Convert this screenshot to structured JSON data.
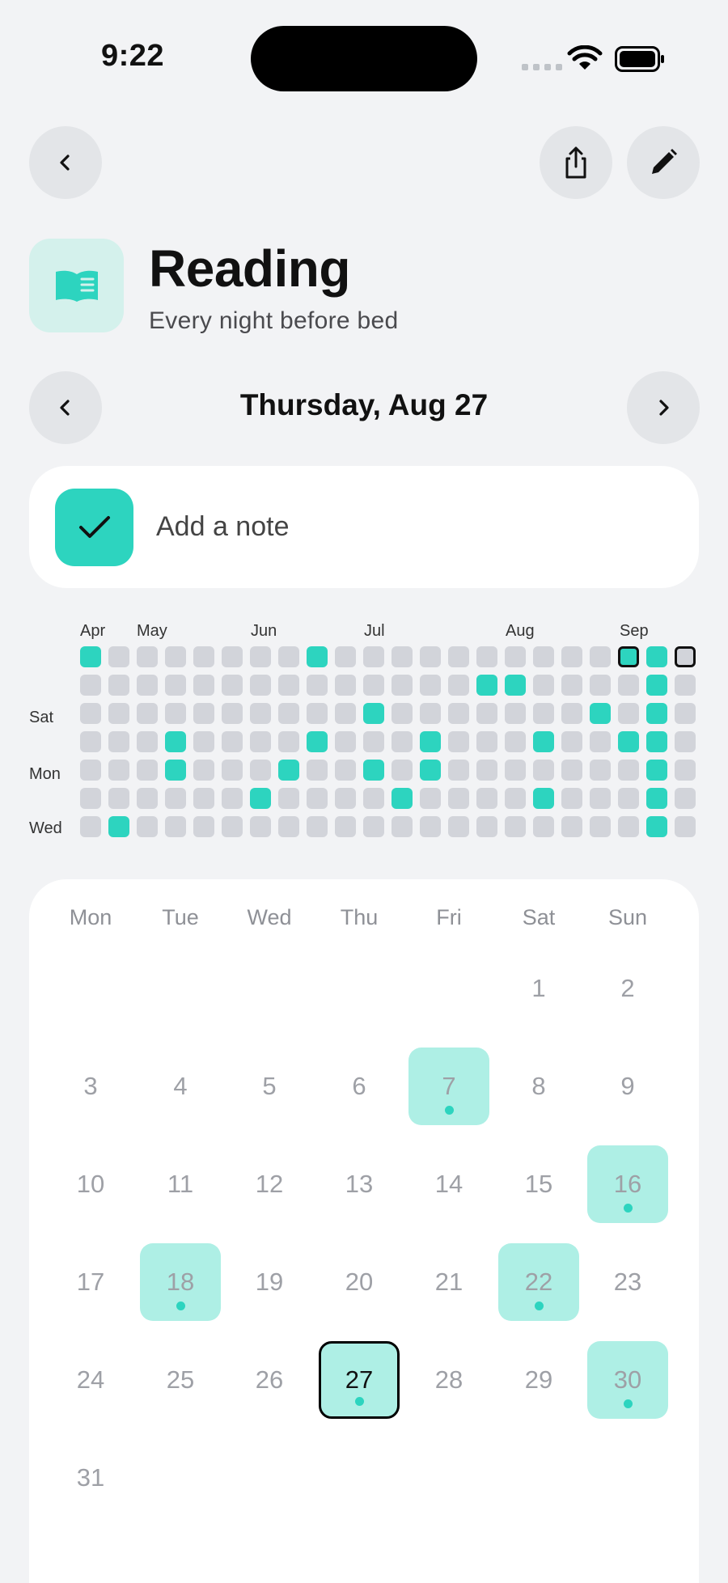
{
  "status_bar": {
    "time": "9:22"
  },
  "header": {
    "title": "Reading",
    "subtitle": "Every night before bed",
    "icon": "open-book-icon"
  },
  "date_nav": {
    "label": "Thursday, Aug 27"
  },
  "note": {
    "placeholder": "Add a note",
    "checked": true
  },
  "heatmap": {
    "months": [
      "Apr",
      "May",
      "Jun",
      "Jul",
      "Aug",
      "Sep"
    ],
    "day_labels": [
      "Sat",
      "Mon",
      "Wed"
    ],
    "weeks": 21,
    "rows": 7,
    "filled": [
      [
        0,
        0
      ],
      [
        8,
        0
      ],
      [
        19,
        0
      ],
      [
        20,
        0
      ],
      [
        14,
        1
      ],
      [
        15,
        1
      ],
      [
        20,
        1
      ],
      [
        10,
        2
      ],
      [
        18,
        2
      ],
      [
        20,
        2
      ],
      [
        3,
        3
      ],
      [
        8,
        3
      ],
      [
        12,
        3
      ],
      [
        16,
        3
      ],
      [
        19,
        3
      ],
      [
        20,
        3
      ],
      [
        3,
        4
      ],
      [
        7,
        4
      ],
      [
        10,
        4
      ],
      [
        12,
        4
      ],
      [
        20,
        4
      ],
      [
        6,
        5
      ],
      [
        11,
        5
      ],
      [
        16,
        5
      ],
      [
        20,
        5
      ],
      [
        1,
        6
      ],
      [
        20,
        6
      ]
    ],
    "outlined": [
      [
        19,
        0
      ],
      [
        21,
        0
      ]
    ]
  },
  "calendar": {
    "weekdays": [
      "Mon",
      "Tue",
      "Wed",
      "Thu",
      "Fri",
      "Sat",
      "Sun"
    ],
    "first_weekday_index": 5,
    "days_in_month": 31,
    "completed_days": [
      7,
      16,
      18,
      22,
      27,
      30
    ],
    "today": 27
  },
  "colors": {
    "accent": "#2DD4BF",
    "accent_light": "#AEEFE5",
    "icon_bg": "#D4F1EC",
    "cell_empty": "#D2D4DA",
    "background": "#F2F3F5"
  }
}
